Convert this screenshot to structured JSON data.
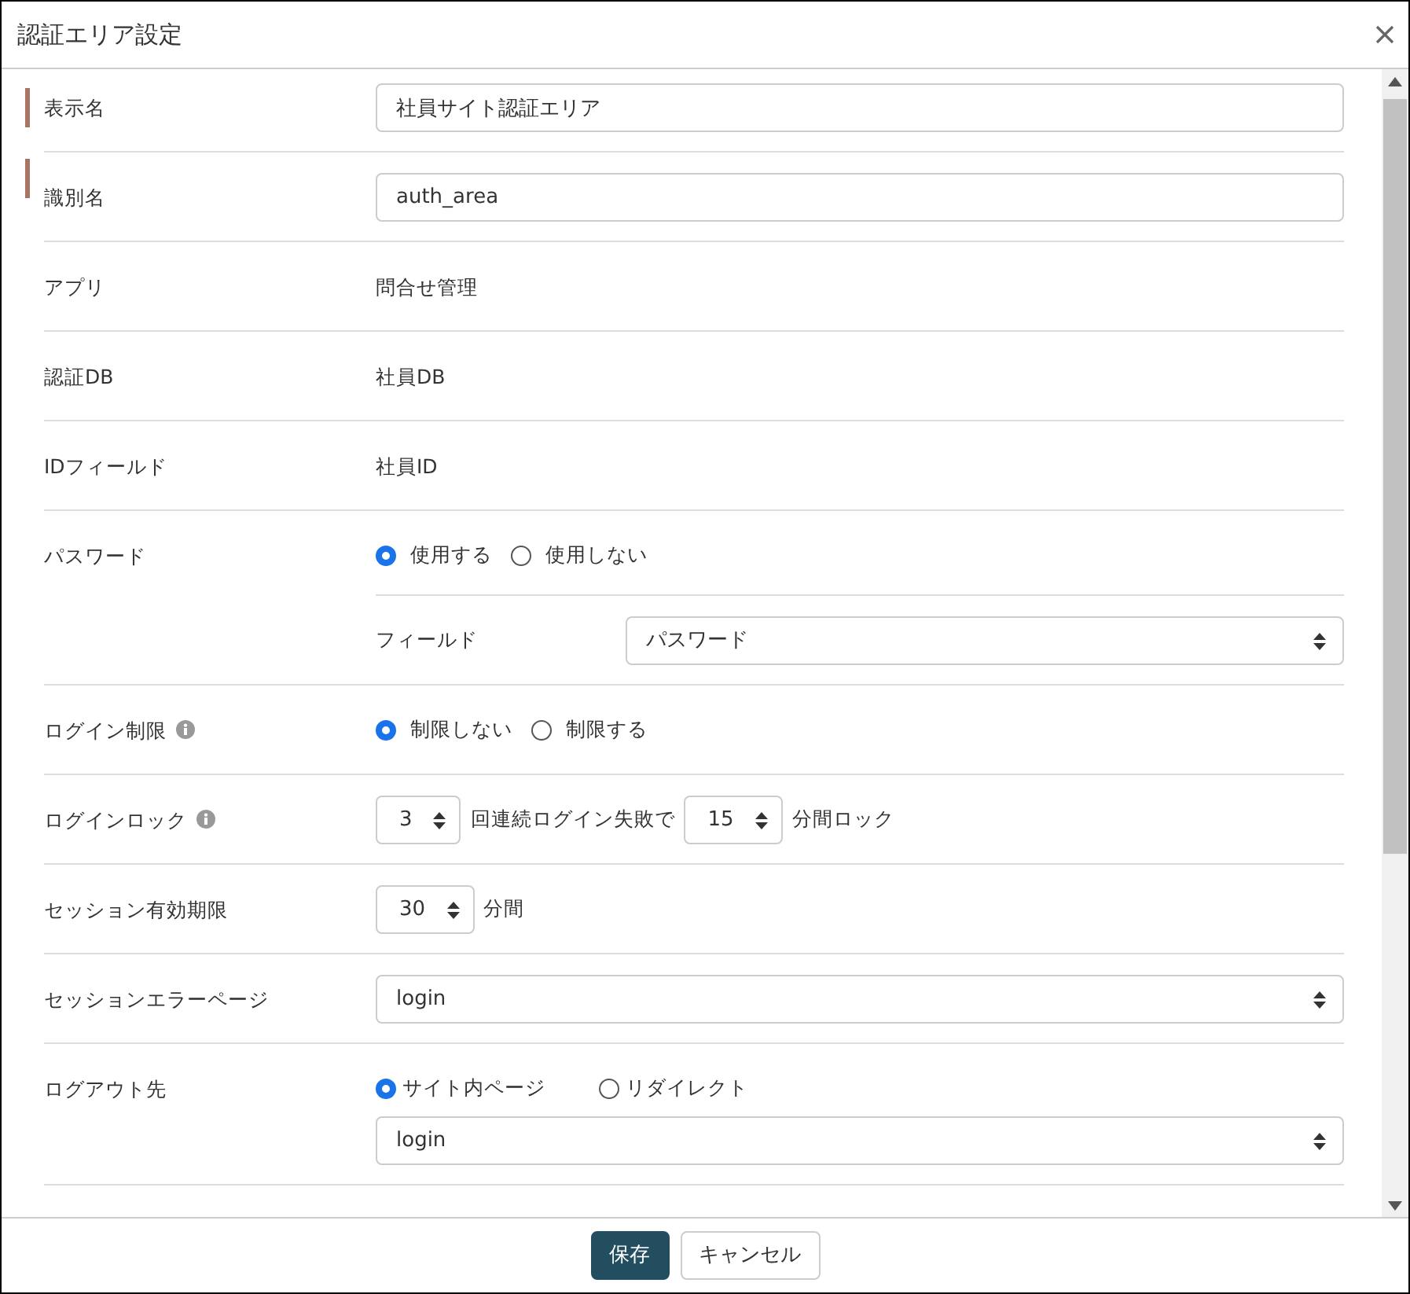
{
  "dialog": {
    "title": "認証エリア設定"
  },
  "rows": [
    {
      "kind": "input",
      "label": "表示名",
      "required": true,
      "info": false,
      "value": "社員サイト認証エリア"
    },
    {
      "kind": "input",
      "label": "識別名",
      "required": true,
      "info": false,
      "value": "auth_area"
    },
    {
      "kind": "static",
      "label": "アプリ",
      "required": false,
      "info": false,
      "value": "問合せ管理"
    },
    {
      "kind": "static",
      "label": "認証DB",
      "required": false,
      "info": false,
      "value": "社員DB"
    },
    {
      "kind": "static",
      "label": "IDフィールド",
      "required": false,
      "info": false,
      "value": "社員ID"
    },
    {
      "kind": "radio",
      "label": "パスワード",
      "required": false,
      "info": false,
      "options": [
        {
          "label": "使用する",
          "selected": true
        },
        {
          "label": "使用しない",
          "selected": false
        }
      ],
      "sub_field": {
        "label": "フィールド",
        "value": "パスワード"
      }
    },
    {
      "kind": "radio",
      "label": "ログイン制限",
      "required": false,
      "info": true,
      "options": [
        {
          "label": "制限しない",
          "selected": true
        },
        {
          "label": "制限する",
          "selected": false
        }
      ]
    },
    {
      "kind": "inline",
      "label": "ログインロック",
      "required": false,
      "info": true,
      "parts": [
        {
          "kind": "select",
          "value": "3"
        },
        {
          "kind": "text",
          "text": "回連続ログイン失敗で"
        },
        {
          "kind": "select",
          "value": "15"
        },
        {
          "kind": "text",
          "text": "分間ロック"
        }
      ]
    },
    {
      "kind": "inline",
      "label": "セッション有効期限",
      "required": false,
      "info": false,
      "parts": [
        {
          "kind": "select",
          "value": "30"
        },
        {
          "kind": "text",
          "text": "分間"
        }
      ]
    },
    {
      "kind": "select",
      "label": "セッションエラーページ",
      "required": false,
      "info": false,
      "value": "login"
    },
    {
      "kind": "radio",
      "label": "ログアウト先",
      "required": false,
      "info": false,
      "options": [
        {
          "label": "サイト内ページ",
          "selected": true
        },
        {
          "label": "リダイレクト",
          "selected": false
        }
      ],
      "select": {
        "value": "login"
      }
    }
  ],
  "buttons": [
    {
      "kind": "primary",
      "label": "保存"
    },
    {
      "kind": "secondary",
      "label": "キャンセル"
    }
  ]
}
